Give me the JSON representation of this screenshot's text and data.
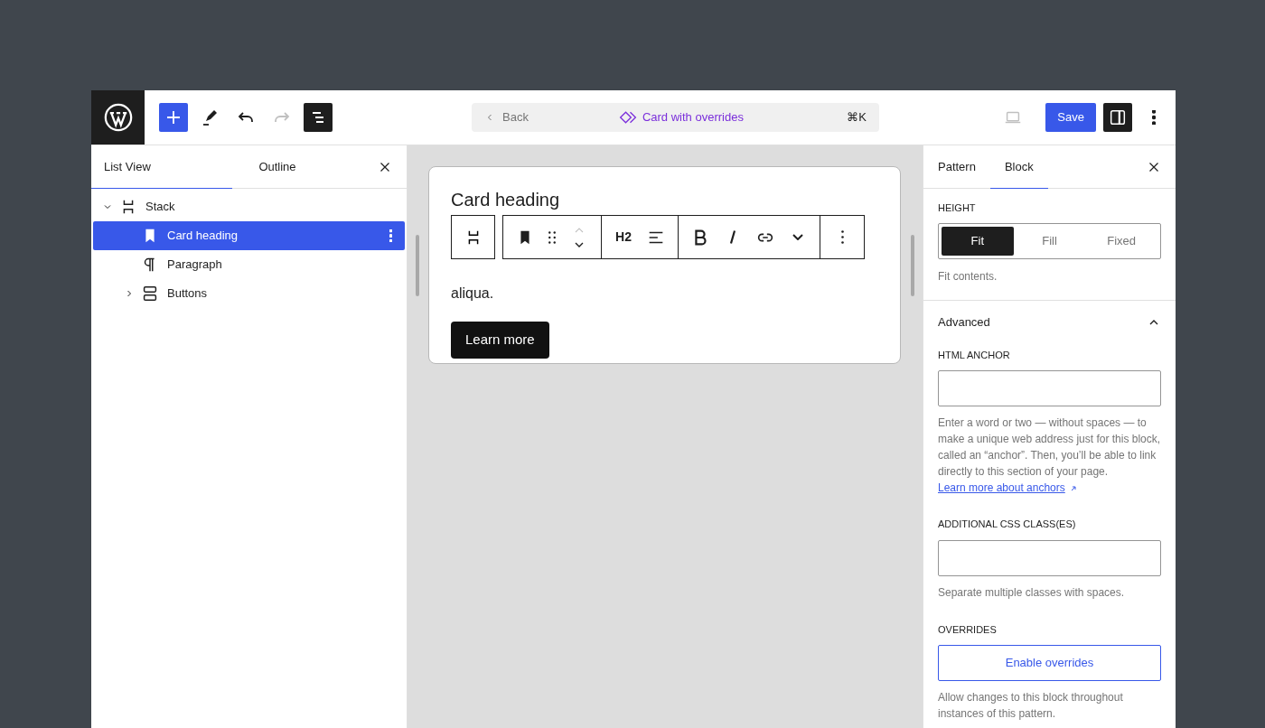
{
  "topbar": {
    "tools": [
      {
        "kind": "add",
        "active": true,
        "disabled": false
      },
      {
        "kind": "edit",
        "active": false,
        "disabled": false
      },
      {
        "kind": "undo",
        "active": false,
        "disabled": false
      },
      {
        "kind": "redo",
        "active": false,
        "disabled": true
      },
      {
        "kind": "list",
        "active": true,
        "disabled": false
      }
    ],
    "command_bar": {
      "back": "Back",
      "title": "Card with overrides",
      "shortcut": "⌘K"
    },
    "save": "Save",
    "preview_disabled": true,
    "settings_active": true
  },
  "list_panel": {
    "tabs": [
      {
        "label": "List View",
        "selected": true
      },
      {
        "label": "Outline",
        "selected": false
      }
    ],
    "tree": [
      {
        "label": "Stack",
        "kind": "stack",
        "expanded": true,
        "selected": false,
        "children": [
          {
            "label": "Card heading",
            "kind": "heading",
            "selected": true
          },
          {
            "label": "Paragraph",
            "kind": "paragraph",
            "selected": false
          },
          {
            "label": "Buttons",
            "kind": "buttons",
            "expanded": false,
            "selected": false
          }
        ]
      }
    ]
  },
  "canvas": {
    "heading": "Card heading",
    "paragraph_visible": "aliqua.",
    "button": "Learn more",
    "toolbar": {
      "heading_level": "H2"
    }
  },
  "inspector": {
    "tabs": [
      {
        "label": "Pattern",
        "selected": false
      },
      {
        "label": "Block",
        "selected": true
      }
    ],
    "height": {
      "label": "HEIGHT",
      "options": [
        {
          "label": "Fit",
          "selected": true
        },
        {
          "label": "Fill",
          "selected": false
        },
        {
          "label": "Fixed",
          "selected": false
        }
      ],
      "help": "Fit contents."
    },
    "advanced": {
      "title": "Advanced",
      "expanded": true,
      "anchor": {
        "label": "HTML ANCHOR",
        "help": "Enter a word or two — without spaces — to make a unique web address just for this block, called an “anchor”. Then, you’ll be able to link directly to this section of your page.",
        "link": "Learn more about anchors"
      },
      "css": {
        "label": "ADDITIONAL CSS CLASS(ES)",
        "help": "Separate multiple classes with spaces."
      },
      "overrides": {
        "label": "OVERRIDES",
        "button": "Enable overrides",
        "help": "Allow changes to this block throughout instances of this pattern."
      }
    }
  }
}
